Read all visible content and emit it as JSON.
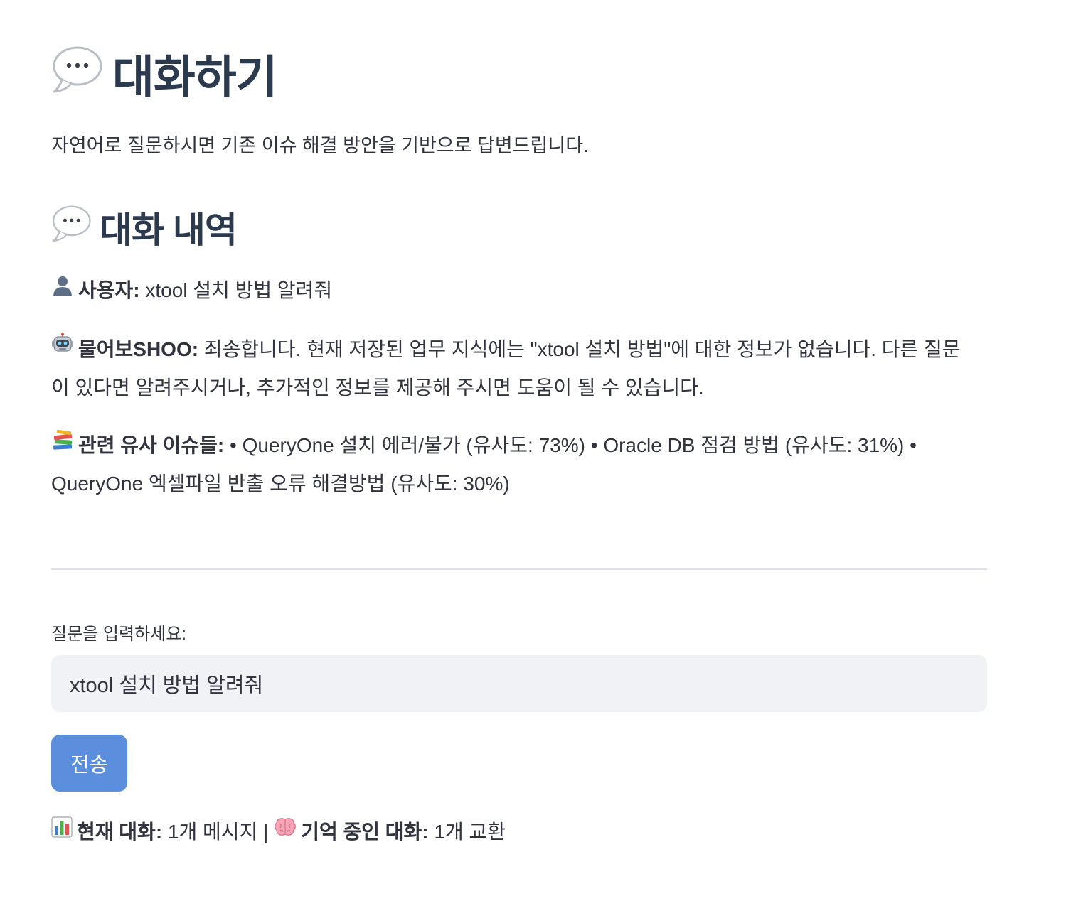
{
  "header": {
    "title": "대화하기",
    "subtitle": "자연어로 질문하시면 기존 이슈 해결 방안을 기반으로 답변드립니다."
  },
  "history": {
    "title": "대화 내역",
    "user_label": "사용자:",
    "user_text": "xtool 설치 방법 알려줘",
    "bot_label": "물어보SHOO:",
    "bot_text": "죄송합니다. 현재 저장된 업무 지식에는 \"xtool 설치 방법\"에 대한 정보가 없습니다. 다른 질문이 있다면 알려주시거나, 추가적인 정보를 제공해 주시면 도움이 될 수 있습니다.",
    "related_label": "관련 유사 이슈들:",
    "related_text": "• QueryOne 설치 에러/불가 (유사도: 73%) • Oracle DB 점검 방법 (유사도: 31%) • QueryOne 엑셀파일 반출 오류 해결방법 (유사도: 30%)"
  },
  "input": {
    "label": "질문을 입력하세요:",
    "value": "xtool 설치 방법 알려줘"
  },
  "send_button": {
    "label": "전송",
    "color": "#5b8fde"
  },
  "stats": {
    "current_label": "현재 대화:",
    "current_value": "1개 메시지",
    "separator": "|",
    "memory_label": "기억 중인 대화:",
    "memory_value": "1개 교환"
  },
  "icons": {
    "title_icon": "speech-bubble-icon",
    "history_icon": "speech-bubble-icon",
    "user_icon": "user-silhouette-icon",
    "bot_icon": "robot-icon",
    "related_icon": "books-icon",
    "stats_icon": "bar-chart-icon",
    "memory_icon": "brain-icon"
  }
}
